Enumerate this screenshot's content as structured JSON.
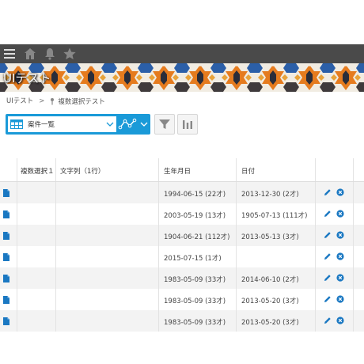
{
  "nav": {
    "icons": [
      "menu-icon",
      "home-icon",
      "bell-icon",
      "star-icon"
    ]
  },
  "banner": {
    "title": "UIテスト"
  },
  "breadcrumb": {
    "root": "UIテスト",
    "separator": ">",
    "current": "複数選択テスト"
  },
  "toolbar": {
    "view_label": "案件一覧"
  },
  "table": {
    "columns": [
      "複数選択１",
      "文字列（1行）",
      "生年月日",
      "日付"
    ],
    "rows": [
      {
        "multi": "",
        "text": "",
        "birthday": "1994-06-15 (22才)",
        "date": "2013-12-30 (2才)"
      },
      {
        "multi": "",
        "text": "",
        "birthday": "2003-05-19 (13才)",
        "date": "1905-07-13 (111才)"
      },
      {
        "multi": "",
        "text": "",
        "birthday": "1904-06-21 (112才)",
        "date": "2013-05-13 (3才)"
      },
      {
        "multi": "",
        "text": "",
        "birthday": "2015-07-15 (1才)",
        "date": ""
      },
      {
        "multi": "",
        "text": "",
        "birthday": "1983-05-09 (33才)",
        "date": "2014-06-10 (2才)"
      },
      {
        "multi": "",
        "text": "",
        "birthday": "1983-05-09 (33才)",
        "date": "2013-05-20 (3才)"
      },
      {
        "multi": "",
        "text": "",
        "birthday": "1983-05-09 (33才)",
        "date": "2013-05-20 (3才)"
      }
    ]
  },
  "colors": {
    "accent": "#1a9ad8",
    "nav_bg": "#4a4a4a",
    "row_alt": "#f3f3f3",
    "delete": "#1a78c2"
  }
}
